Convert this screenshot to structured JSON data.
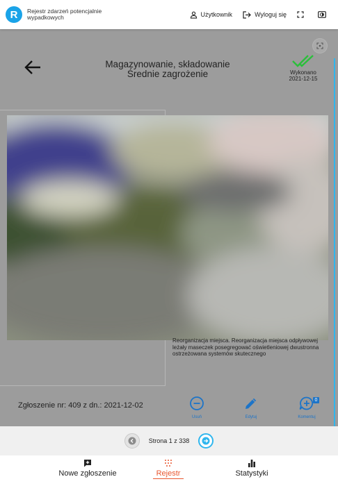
{
  "header": {
    "app_title": "Rejestr zdarzeń potencjalnie wypadkowych",
    "logo_letter": "R",
    "user_label": "Użytkownik",
    "logout_label": "Wyloguj się"
  },
  "record": {
    "category": "Magazynowanie, składowanie",
    "risk": "Średnie zagrożenie",
    "status_label": "Wykonano",
    "status_date": "2021-12-15",
    "description": "Reorganizacja miejsca. Reorganizacja miejsca odpływowej leżały maseczek posegregować oświetleniowej dwustronna ostrzeżowana systemów skutecznego",
    "report_info": "Zgłoszenie nr: 409 z dn.: 2021-12-02",
    "actions": {
      "delete_label": "Usuń",
      "edit_label": "Edytuj",
      "comments_label": "Komentuj",
      "comments_count": "0"
    }
  },
  "pagination": {
    "text": "Strona 1 z 338"
  },
  "bottom_nav": {
    "new_label": "Nowe zgłoszenie",
    "register_label": "Rejestr",
    "stats_label": "Statystyki"
  },
  "colors": {
    "accent": "#2fb6ee",
    "logo": "#1aa3e8",
    "done_green": "#2bbf3b",
    "action_blue": "#1c74c8",
    "active_nav": "#e8562f"
  }
}
